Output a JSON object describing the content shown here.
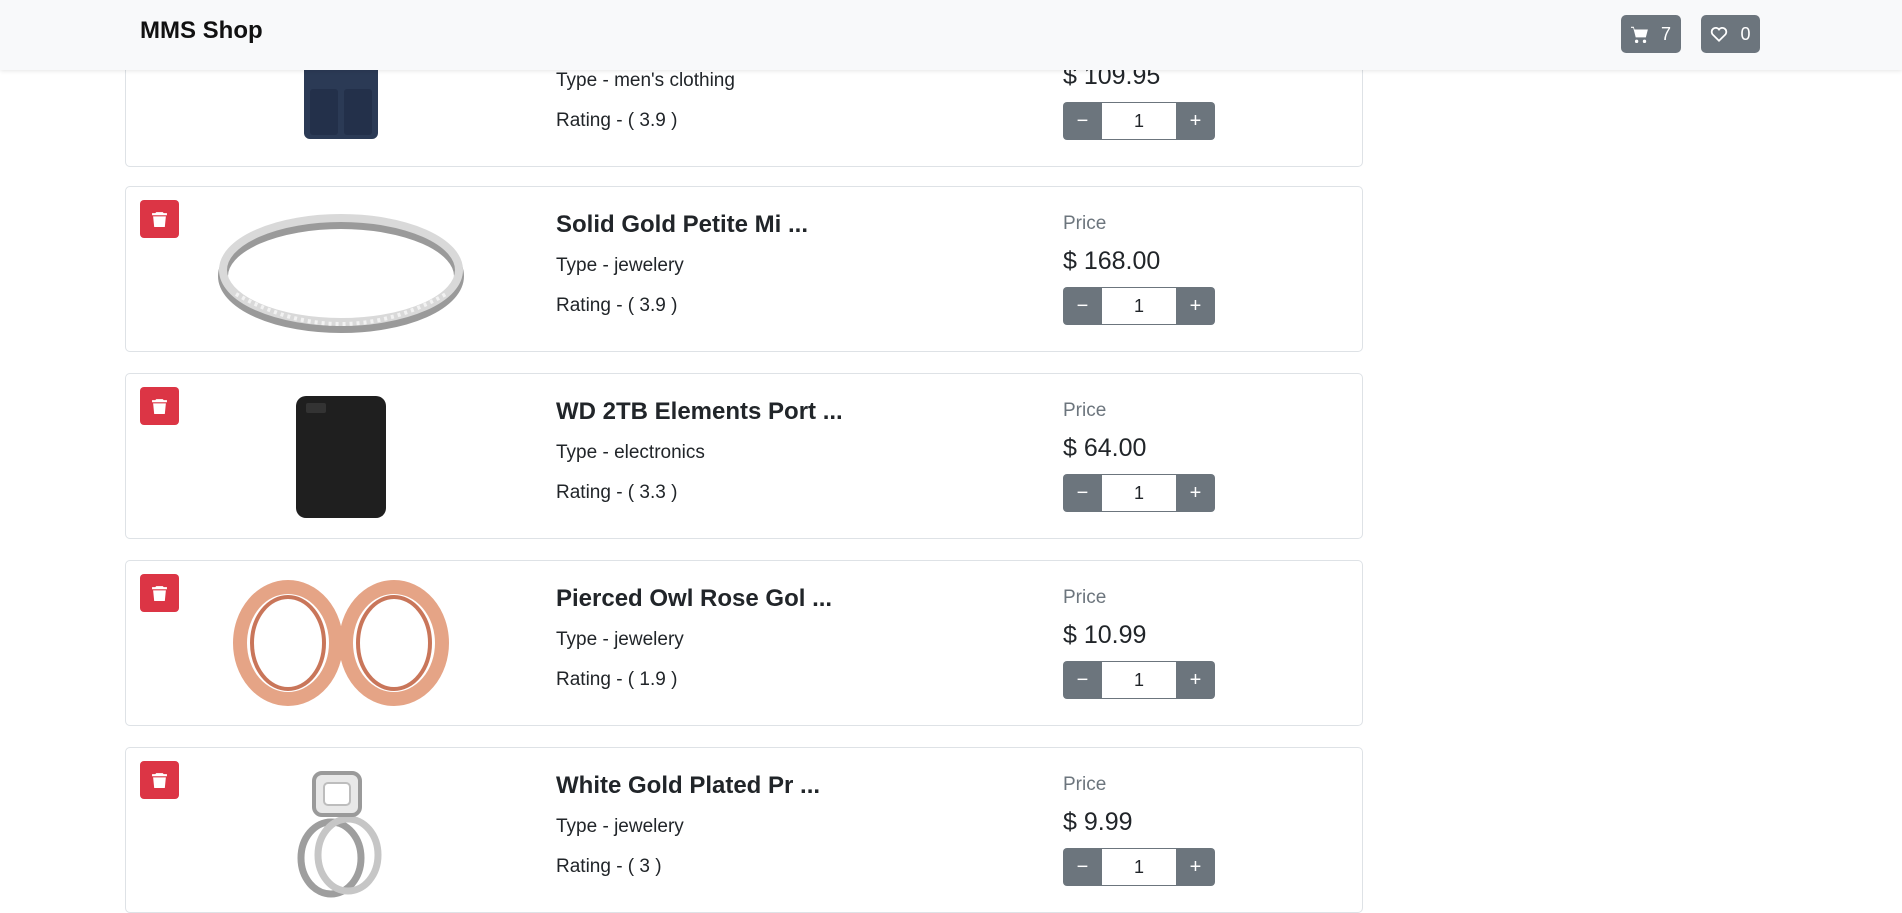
{
  "navbar": {
    "brand": "MMS Shop",
    "cart_icon": "cart-icon",
    "cart_count": "7",
    "wishlist_icon": "heart-icon",
    "wishlist_count": "0"
  },
  "labels": {
    "price": "Price"
  },
  "colors": {
    "delete": "#dc3545",
    "secondary": "#6c757d",
    "navbar": "#f8f9fa"
  },
  "items": [
    {
      "title": "",
      "type": "Type - men's clothing",
      "rating": "Rating - ( 3.9 )",
      "price_label": "",
      "price": "$ 109.95",
      "qty": "1"
    },
    {
      "title": "Solid Gold Petite Mi ...",
      "type": "Type - jewelery",
      "rating": "Rating - ( 3.9 )",
      "price_label": "Price",
      "price": "$ 168.00",
      "qty": "1"
    },
    {
      "title": "WD 2TB Elements Port ...",
      "type": "Type - electronics",
      "rating": "Rating - ( 3.3 )",
      "price_label": "Price",
      "price": "$ 64.00",
      "qty": "1"
    },
    {
      "title": "Pierced Owl Rose Gol ...",
      "type": "Type - jewelery",
      "rating": "Rating - ( 1.9 )",
      "price_label": "Price",
      "price": "$ 10.99",
      "qty": "1"
    },
    {
      "title": "White Gold Plated Pr ...",
      "type": "Type - jewelery",
      "rating": "Rating - ( 3 )",
      "price_label": "Price",
      "price": "$ 9.99",
      "qty": "1"
    }
  ]
}
